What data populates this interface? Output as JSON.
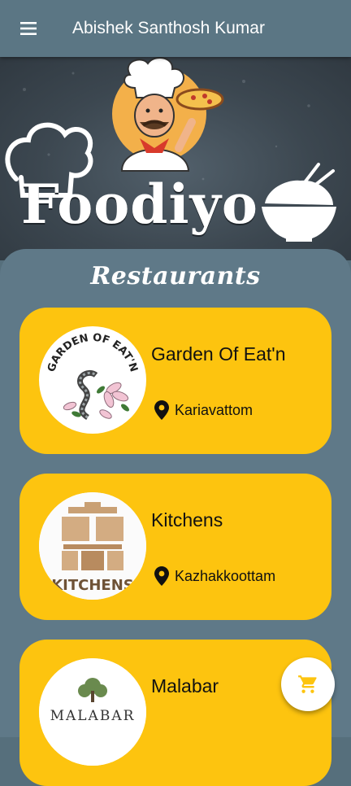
{
  "appbar": {
    "title": "Abishek Santhosh Kumar",
    "menu_icon": "menu-icon"
  },
  "banner": {
    "brand_name": "Foodiyo"
  },
  "section": {
    "title": "Restaurants"
  },
  "restaurants": [
    {
      "name": "Garden Of Eat'n",
      "location": "Kariavattom",
      "logo_text": "GARDEN OF EAT'N",
      "logo_icon": "snake-flower-logo-icon"
    },
    {
      "name": "Kitchens",
      "location": "Kazhakkoottam",
      "logo_text": "KITCHENS",
      "logo_icon": "kitchen-logo-icon"
    },
    {
      "name": "Malabar",
      "location": "",
      "logo_text": "MALABAR",
      "logo_icon": "tree-logo-icon"
    }
  ],
  "fab": {
    "icon": "cart-icon"
  },
  "colors": {
    "appbar": "#5b7684",
    "sheet": "#5f7988",
    "card": "#fdc40f",
    "text": "#111111"
  }
}
